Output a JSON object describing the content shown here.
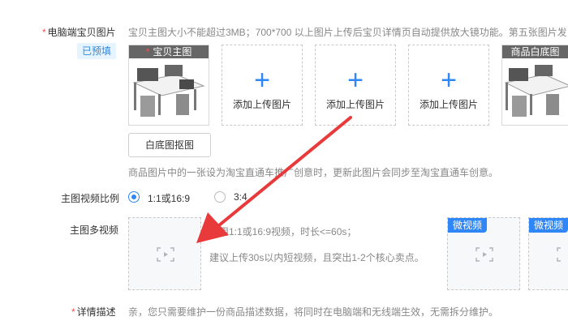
{
  "colors": {
    "accent": "#2f86f6",
    "required": "#ff4d4f",
    "tag_bg": "#e6f4ff",
    "arrow": "#e8393b"
  },
  "pc_images": {
    "label": "电脑端宝贝图片",
    "required_mark": "*",
    "help": "宝贝主图大小不能超过3MB；700*700 以上图片上传后宝贝详情页自动提供放大镜功能。第五张图片发",
    "prefilled_badge": "已预填",
    "main_slot_title": "宝贝主图",
    "main_slot_star": "*",
    "upload_label": "添加上传图片",
    "white_bg_slot_title": "商品白底图",
    "white_bg_button": "白底图抠图",
    "note": "商品图片中的一张设为淘宝直通车推广创意时，更新此图片会同步至淘宝直通车创意。",
    "icon": "plus-icon"
  },
  "video_ratio": {
    "label": "主图视频比例",
    "options": [
      {
        "label": "1:1或16:9",
        "selected": true
      },
      {
        "label": "3:4",
        "selected": false
      }
    ]
  },
  "multi_video": {
    "label": "主图多视频",
    "hint1": "使用1:1或16:9视频，时长<=60s；",
    "hint2": "建议上传30s以内短视频，且突出1-2个核心卖点。",
    "tag_micro": "微视频",
    "icon": "video-frame-icon"
  },
  "detail": {
    "label": "详情描述",
    "required_mark": "*",
    "text": "亲，您只需要维护一份商品描述数据，将同时在电脑端和无线端生效，无需拆分维护。"
  }
}
